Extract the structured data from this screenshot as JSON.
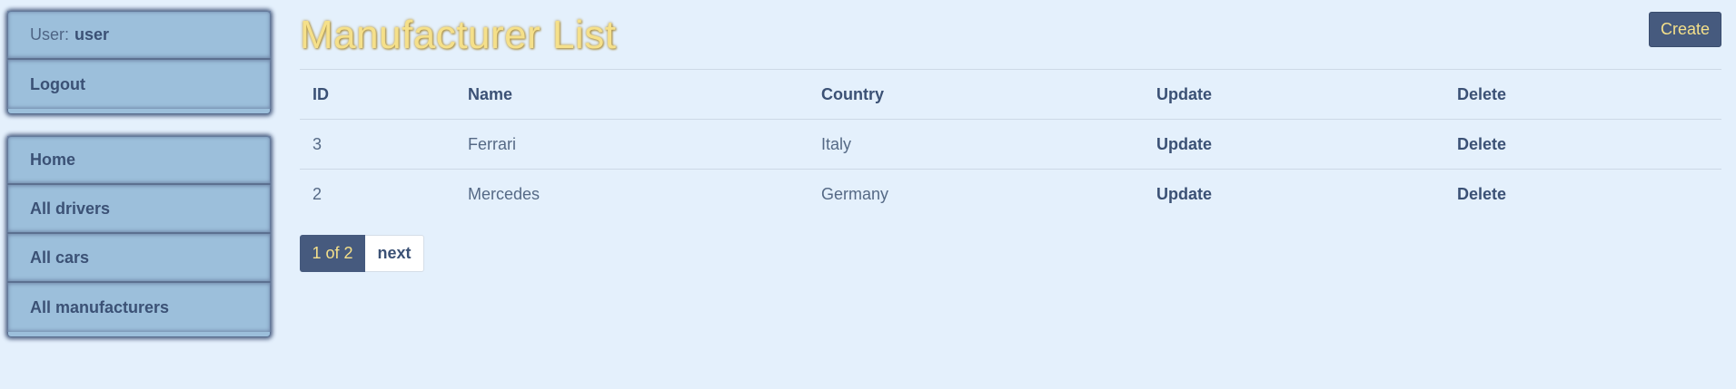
{
  "sidebar": {
    "user_label": "User:",
    "user_name": "user",
    "logout_label": "Logout",
    "nav": [
      {
        "label": "Home"
      },
      {
        "label": "All drivers"
      },
      {
        "label": "All cars"
      },
      {
        "label": "All manufacturers"
      }
    ]
  },
  "main": {
    "title": "Manufacturer List",
    "create_label": "Create",
    "table": {
      "headers": [
        "ID",
        "Name",
        "Country",
        "Update",
        "Delete"
      ],
      "rows": [
        {
          "id": "3",
          "name": "Ferrari",
          "country": "Italy",
          "update": "Update",
          "delete": "Delete"
        },
        {
          "id": "2",
          "name": "Mercedes",
          "country": "Germany",
          "update": "Update",
          "delete": "Delete"
        }
      ]
    },
    "pagination": {
      "current": "1 of 2",
      "next": "next"
    }
  },
  "colors": {
    "background": "#e4f0fc",
    "sidebar": "#9cbfdb",
    "accent_dark": "#465a7e",
    "title_gold": "#f5e08a"
  }
}
